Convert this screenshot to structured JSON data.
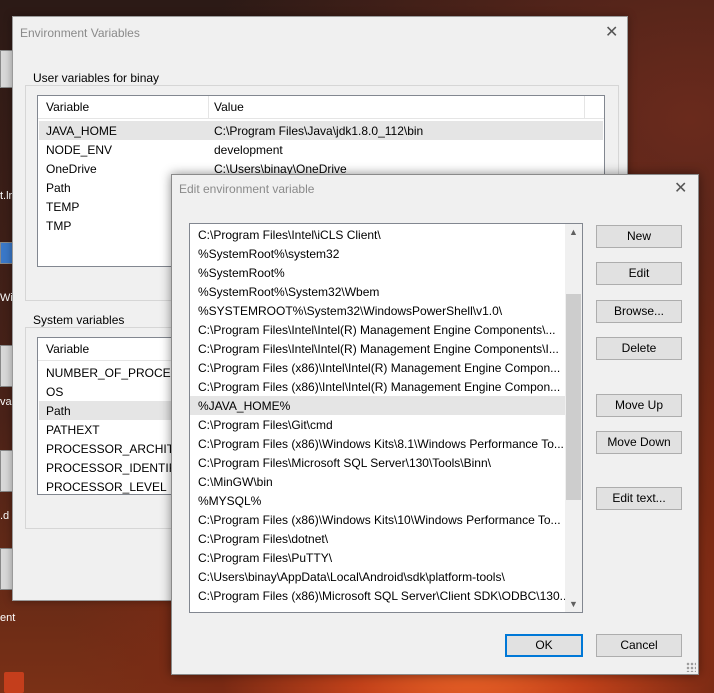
{
  "desktop": {
    "labels": [
      "t.lr",
      "Wi",
      "va",
      ".d",
      "ent"
    ],
    "taskbar_icon": "powerpoint-icon"
  },
  "env_dialog": {
    "title": "Environment Variables",
    "close_icon": "close-icon",
    "user_group_label": "User variables for binay",
    "user_columns": [
      "Variable",
      "Value"
    ],
    "user_rows": [
      {
        "variable": "JAVA_HOME",
        "value": "C:\\Program Files\\Java\\jdk1.8.0_112\\bin"
      },
      {
        "variable": "NODE_ENV",
        "value": "development"
      },
      {
        "variable": "OneDrive",
        "value": "C:\\Users\\binay\\OneDrive"
      },
      {
        "variable": "Path",
        "value": ""
      },
      {
        "variable": "TEMP",
        "value": ""
      },
      {
        "variable": "TMP",
        "value": ""
      }
    ],
    "system_group_label": "System variables",
    "system_columns": [
      "Variable"
    ],
    "system_rows": [
      {
        "variable": "NUMBER_OF_PROCESSORS"
      },
      {
        "variable": "OS"
      },
      {
        "variable": "Path"
      },
      {
        "variable": "PATHEXT"
      },
      {
        "variable": "PROCESSOR_ARCHITECTURE"
      },
      {
        "variable": "PROCESSOR_IDENTIFIER"
      },
      {
        "variable": "PROCESSOR_LEVEL"
      }
    ]
  },
  "edit_dialog": {
    "title": "Edit environment variable",
    "close_icon": "close-icon",
    "paths": [
      "C:\\Program Files\\Intel\\iCLS Client\\",
      "%SystemRoot%\\system32",
      "%SystemRoot%",
      "%SystemRoot%\\System32\\Wbem",
      "%SYSTEMROOT%\\System32\\WindowsPowerShell\\v1.0\\",
      "C:\\Program Files\\Intel\\Intel(R) Management Engine Components\\...",
      "C:\\Program Files\\Intel\\Intel(R) Management Engine Components\\I...",
      "C:\\Program Files (x86)\\Intel\\Intel(R) Management Engine Compon...",
      "C:\\Program Files (x86)\\Intel\\Intel(R) Management Engine Compon...",
      "%JAVA_HOME%",
      "C:\\Program Files\\Git\\cmd",
      "C:\\Program Files (x86)\\Windows Kits\\8.1\\Windows Performance To...",
      "C:\\Program Files\\Microsoft SQL Server\\130\\Tools\\Binn\\",
      "C:\\MinGW\\bin",
      "%MYSQL%",
      "C:\\Program Files (x86)\\Windows Kits\\10\\Windows Performance To...",
      "C:\\Program Files\\dotnet\\",
      "C:\\Program Files\\PuTTY\\",
      "C:\\Users\\binay\\AppData\\Local\\Android\\sdk\\platform-tools\\",
      "C:\\Program Files (x86)\\Microsoft SQL Server\\Client SDK\\ODBC\\130...."
    ],
    "selected_path_index": 9,
    "buttons": {
      "new": "New",
      "edit": "Edit",
      "browse": "Browse...",
      "delete": "Delete",
      "move_up": "Move Up",
      "move_down": "Move Down",
      "edit_text": "Edit text...",
      "ok": "OK",
      "cancel": "Cancel"
    },
    "scroll_up_icon": "scroll-up-arrow-icon",
    "scroll_down_icon": "scroll-down-arrow-icon"
  }
}
